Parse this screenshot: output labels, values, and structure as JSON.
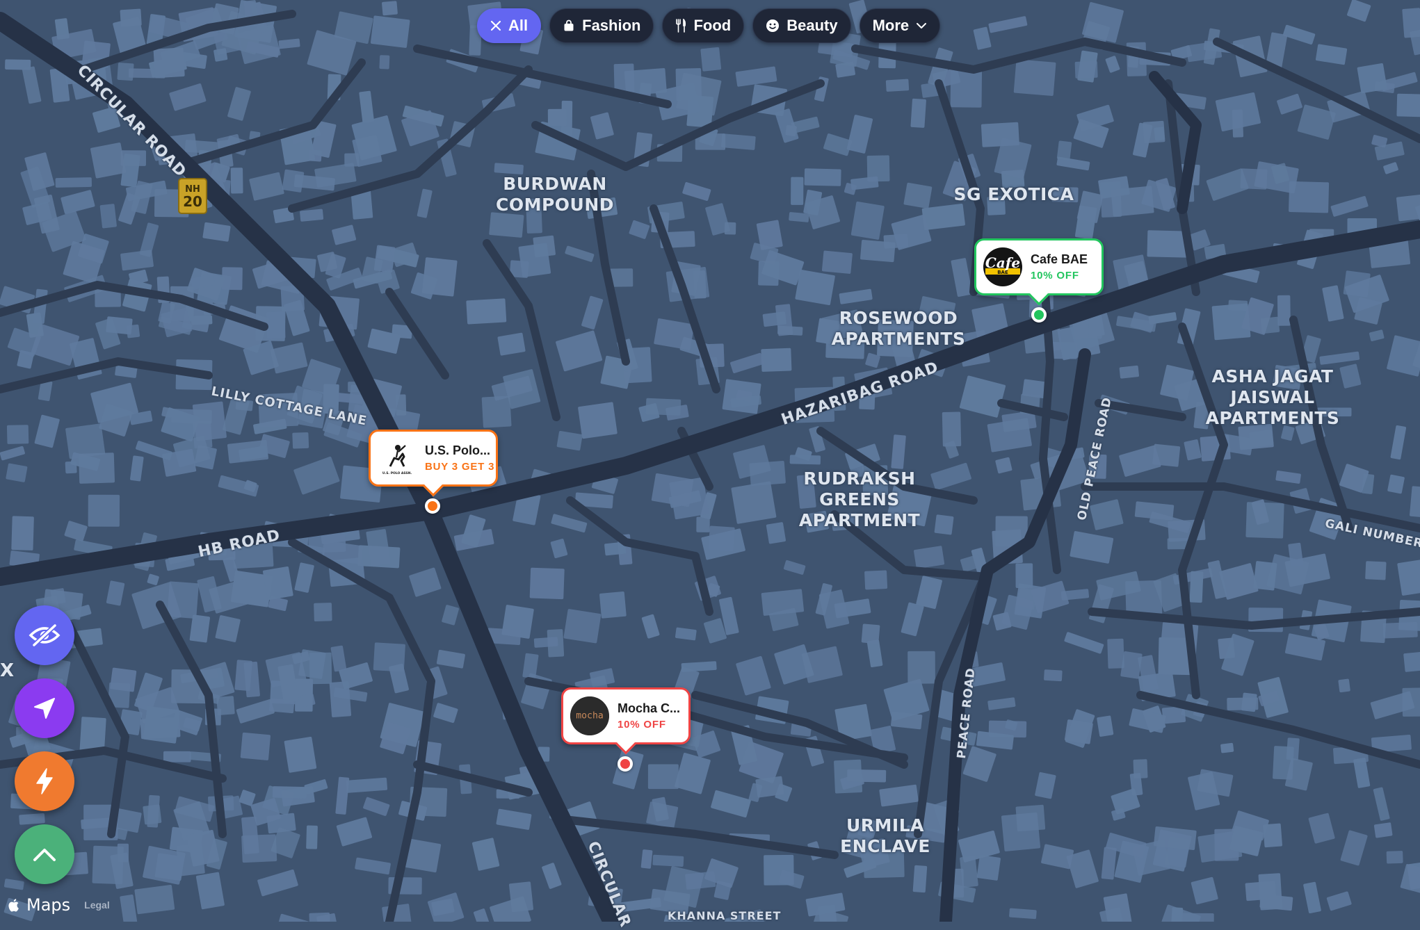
{
  "filters": [
    {
      "label": "All",
      "icon": "close-icon",
      "active": true
    },
    {
      "label": "Fashion",
      "icon": "shopping-bag-icon",
      "active": false
    },
    {
      "label": "Food",
      "icon": "fork-knife-icon",
      "active": false
    },
    {
      "label": "Beauty",
      "icon": "smiley-icon",
      "active": false
    },
    {
      "label": "More",
      "icon": "chevron-down-icon",
      "active": false
    }
  ],
  "map": {
    "places": [
      {
        "text": "BURDWAN\nCOMPOUND"
      },
      {
        "text": "SG EXOTICA"
      },
      {
        "text": "ROSEWOOD\nAPARTMENTS"
      },
      {
        "text": "ASHA JAGAT\nJAISWAL\nAPARTMENTS"
      },
      {
        "text": "RUDRAKSH\nGREENS\nAPARTMENT"
      },
      {
        "text": "URMILA\nENCLAVE"
      }
    ],
    "roads": [
      {
        "text": "CIRCULAR ROAD"
      },
      {
        "text": "LILLY COTTAGE LANE"
      },
      {
        "text": "HB ROAD"
      },
      {
        "text": "HAZARIBAG ROAD"
      },
      {
        "text": "OLD PEACE ROAD"
      },
      {
        "text": "PEACE ROAD"
      },
      {
        "text": "GALI NUMBER"
      },
      {
        "text": "CIRCULAR"
      },
      {
        "text": "KHANNA STREET"
      }
    ],
    "highway_shield": {
      "line1": "NH",
      "line2": "20"
    },
    "edge_glyph": "X"
  },
  "pins": [
    {
      "name": "Cafe BAE",
      "offer": "10% OFF",
      "color": "#22c55e",
      "offer_color": "#22c55e",
      "logo": "cafe-bae-logo",
      "logo_text": "Cafe",
      "logo_sub": "BAE"
    },
    {
      "name": "U.S. Polo...",
      "offer": "BUY 3 GET 3",
      "color": "#f97316",
      "offer_color": "#f97316",
      "logo": "us-polo-logo",
      "logo_text": "U.S. POLO ASSN."
    },
    {
      "name": "Mocha C...",
      "offer": "10% OFF",
      "color": "#ef4444",
      "offer_color": "#ef4444",
      "logo": "mocha-logo",
      "logo_text": "mocha"
    }
  ],
  "fabs": [
    {
      "icon": "eye-off-icon",
      "color": "#6366f1"
    },
    {
      "icon": "navigation-arrow-icon",
      "color": "#8b3bf0"
    },
    {
      "icon": "lightning-icon",
      "color": "#f07a2f"
    },
    {
      "icon": "chevron-up-icon",
      "color": "#4bb17a"
    }
  ],
  "attribution": {
    "brand": "Maps",
    "legal": "Legal"
  }
}
